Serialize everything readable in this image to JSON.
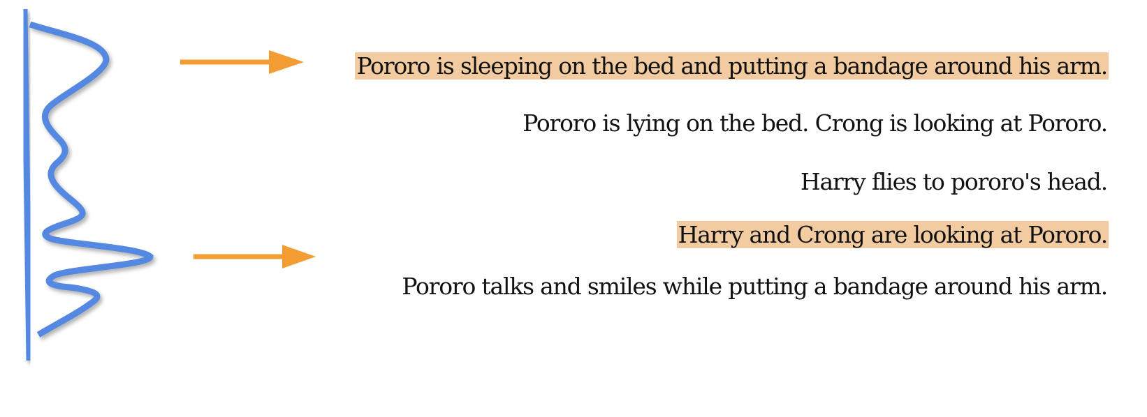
{
  "colors": {
    "curve": "#5588e0",
    "arrow": "#f39c33",
    "highlight": "#f2cba0"
  },
  "captions": [
    {
      "text": "Pororo is sleeping on the bed and putting a bandage around his arm.",
      "highlighted": true
    },
    {
      "text": "Pororo is lying on the bed. Crong is looking at Pororo.",
      "highlighted": false
    },
    {
      "text": "Harry flies to pororo's head.",
      "highlighted": false
    },
    {
      "text": "Harry and Crong are looking at Pororo.",
      "highlighted": true
    },
    {
      "text": "Pororo talks and smiles while putting a bandage around his arm.",
      "highlighted": false
    }
  ]
}
